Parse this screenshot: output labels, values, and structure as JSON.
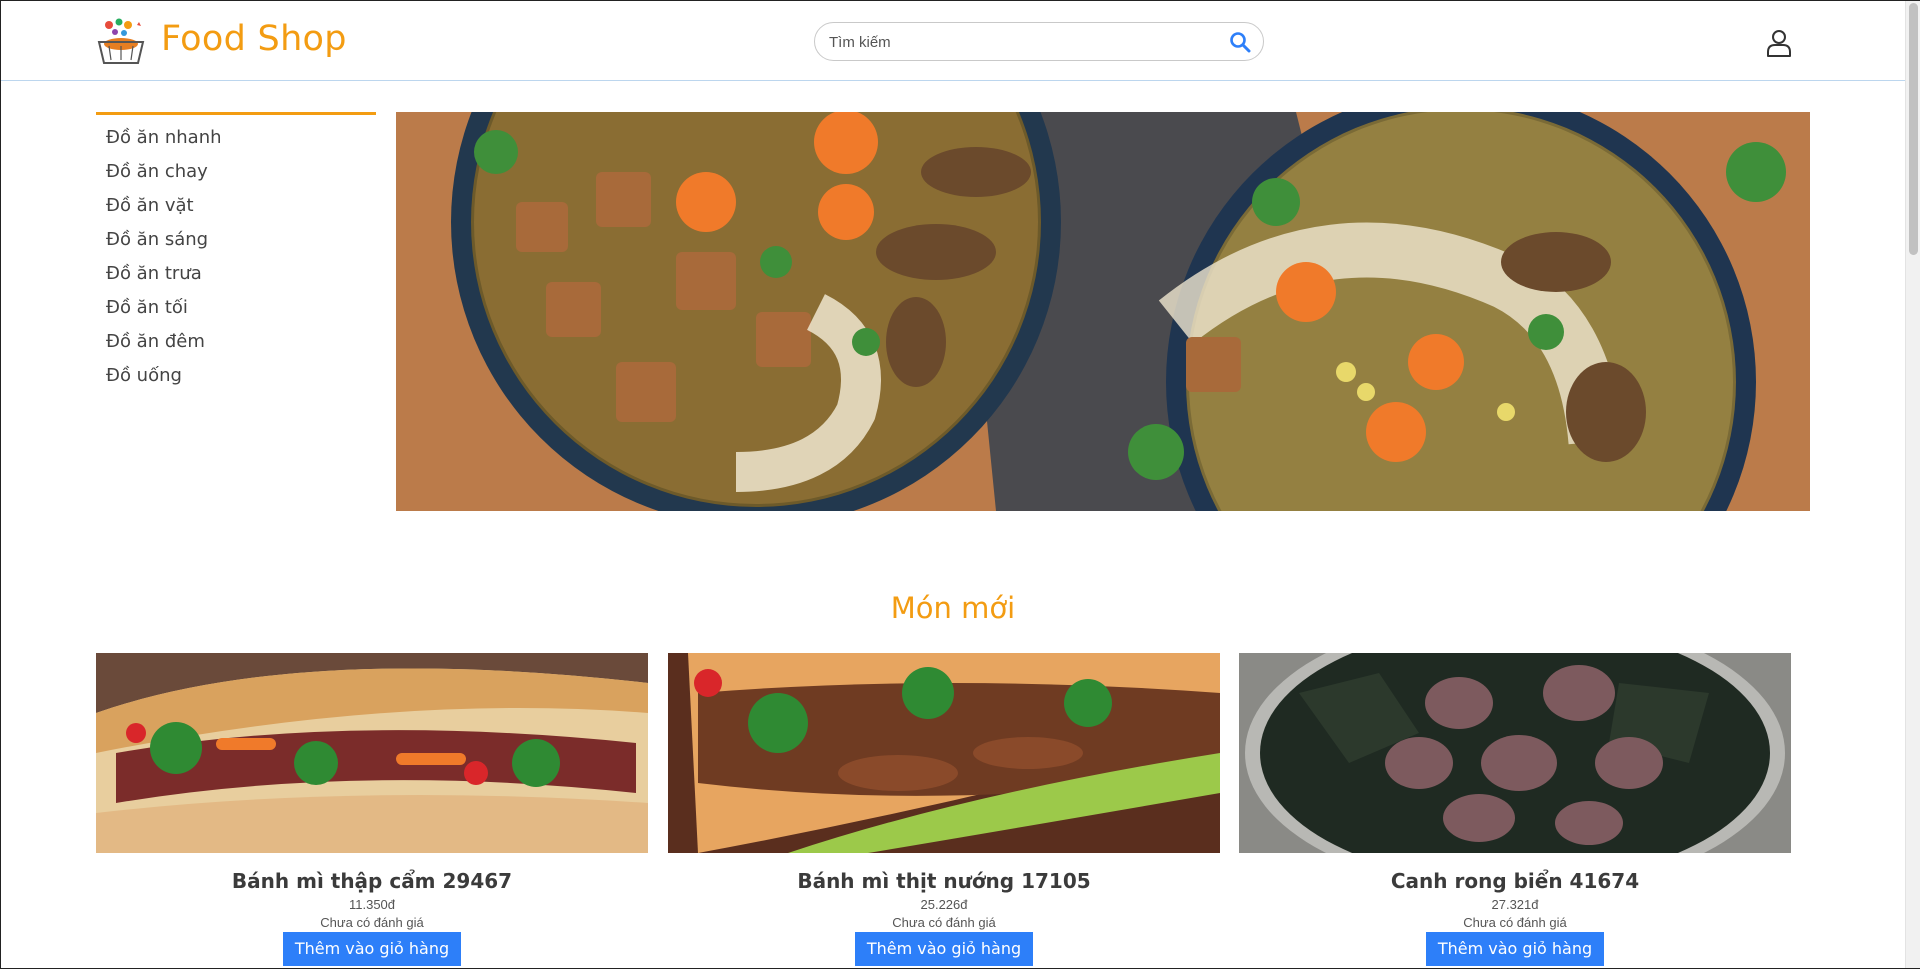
{
  "header": {
    "brand": "Food Shop",
    "search_placeholder": "Tìm kiếm"
  },
  "sidebar": {
    "items": [
      {
        "label": "Đồ ăn nhanh"
      },
      {
        "label": "Đồ ăn chay"
      },
      {
        "label": "Đồ ăn vặt"
      },
      {
        "label": "Đồ ăn sáng"
      },
      {
        "label": "Đồ ăn trưa"
      },
      {
        "label": "Đồ ăn tối"
      },
      {
        "label": "Đồ ăn đêm"
      },
      {
        "label": "Đồ uống"
      }
    ]
  },
  "section": {
    "title": "Món mới"
  },
  "products": [
    {
      "name": "Bánh mì thập cẩm 29467",
      "price": "11.350đ",
      "rating": "Chưa có đánh giá",
      "button": "Thêm vào giỏ hàng"
    },
    {
      "name": "Bánh mì thịt nướng 17105",
      "price": "25.226đ",
      "rating": "Chưa có đánh giá",
      "button": "Thêm vào giỏ hàng"
    },
    {
      "name": "Canh rong biển 41674",
      "price": "27.321đ",
      "rating": "Chưa có đánh giá",
      "button": "Thêm vào giỏ hàng"
    }
  ],
  "colors": {
    "accent": "#f39c12",
    "button": "#2d7ff9",
    "search_icon": "#2d7ff9"
  },
  "icons": {
    "logo": "food-basket-logo",
    "search": "search-icon",
    "user": "user-icon"
  }
}
